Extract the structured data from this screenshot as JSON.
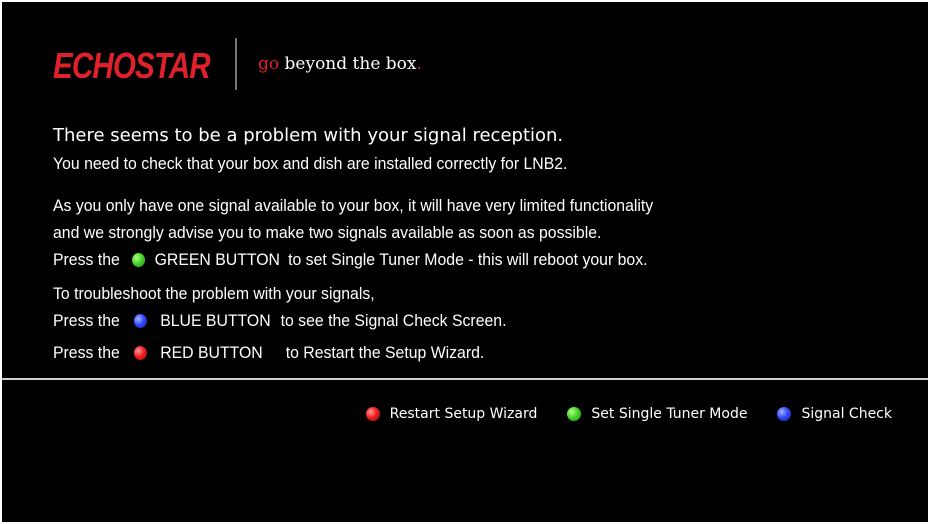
{
  "header": {
    "brand": "ECHOSTAR",
    "tagline_prefix": "go",
    "tagline_main": " beyond the box",
    "tagline_suffix": "."
  },
  "message": {
    "title": "There seems to be a problem with your signal reception.",
    "check_line": "You need to check that your box and dish are installed correctly for LNB2.",
    "limited_line1": "As you only have one signal available to your box, it will have very limited functionality",
    "limited_line2": "and we strongly advise you to make two signals available as soon as possible.",
    "green_prefix": "Press the",
    "green_button": "GREEN BUTTON",
    "green_suffix": "to set Single Tuner Mode - this will reboot your box.",
    "troubleshoot_line": "To troubleshoot the problem with your signals,",
    "blue_prefix": "Press the",
    "blue_button": "BLUE BUTTON",
    "blue_suffix": "to see the Signal Check Screen.",
    "red_prefix": "Press the",
    "red_button": "RED BUTTON",
    "red_suffix": "to Restart the Setup Wizard."
  },
  "footer": {
    "restart_label": "Restart Setup Wizard",
    "single_tuner_label": "Set Single Tuner Mode",
    "signal_check_label": "Signal Check"
  },
  "colors": {
    "background": "#000000",
    "brand_red": "#e0202a",
    "green_key": "#45d42a",
    "blue_key": "#3448ff",
    "red_key": "#f01e1e"
  }
}
